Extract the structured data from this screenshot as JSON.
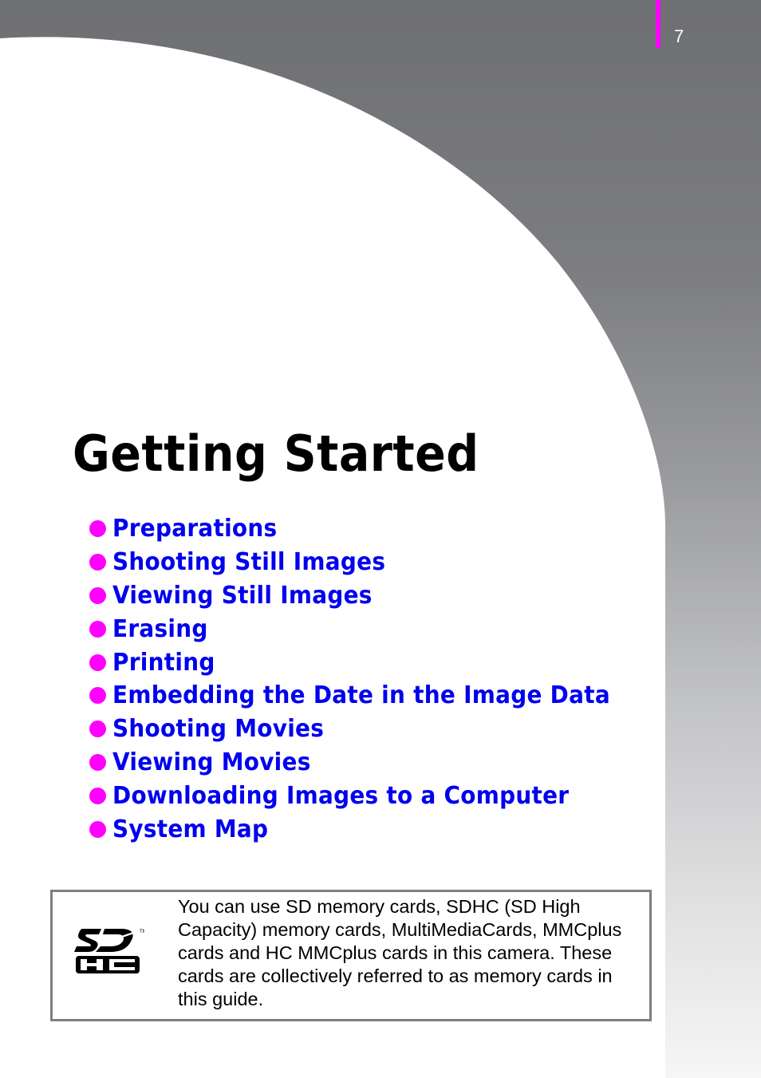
{
  "page": {
    "number": "7",
    "title": "Getting Started",
    "accent_color": "#ff00ff",
    "link_color": "#0000ee"
  },
  "toc": [
    {
      "label": "Preparations"
    },
    {
      "label": "Shooting Still Images"
    },
    {
      "label": "Viewing Still Images"
    },
    {
      "label": "Erasing"
    },
    {
      "label": "Printing"
    },
    {
      "label": "Embedding the Date in the Image Data"
    },
    {
      "label": "Shooting Movies"
    },
    {
      "label": "Viewing Movies"
    },
    {
      "label": "Downloading Images to a Computer"
    },
    {
      "label": "System Map"
    }
  ],
  "note": {
    "icon": "sdhc-logo-icon",
    "text": "You can use SD memory cards, SDHC (SD High Capacity) memory cards, MultiMediaCards, MMCplus cards and HC MMCplus cards in this camera. These cards are collectively referred to as memory cards in this guide."
  }
}
